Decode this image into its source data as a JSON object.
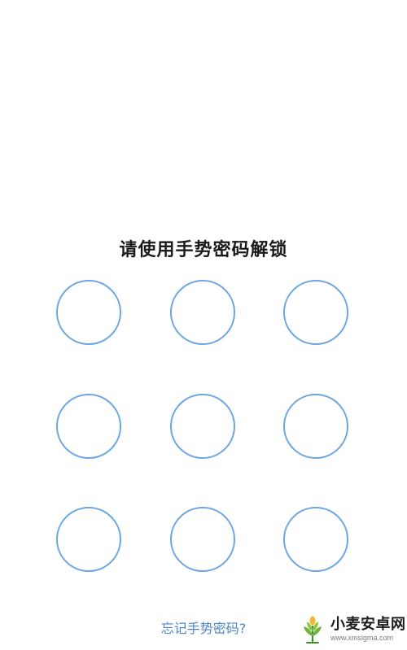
{
  "lock_screen": {
    "title": "请使用手势密码解锁",
    "forgot_label": "忘记手势密码?",
    "pattern_dots": [
      "1",
      "2",
      "3",
      "4",
      "5",
      "6",
      "7",
      "8",
      "9"
    ],
    "accent_color": "#6aa6e4",
    "link_color": "#4d86c6"
  },
  "watermark": {
    "name": "小麦安卓网",
    "url": "www.xmsigma.com",
    "logo_icon": "wheat-plant-icon"
  }
}
